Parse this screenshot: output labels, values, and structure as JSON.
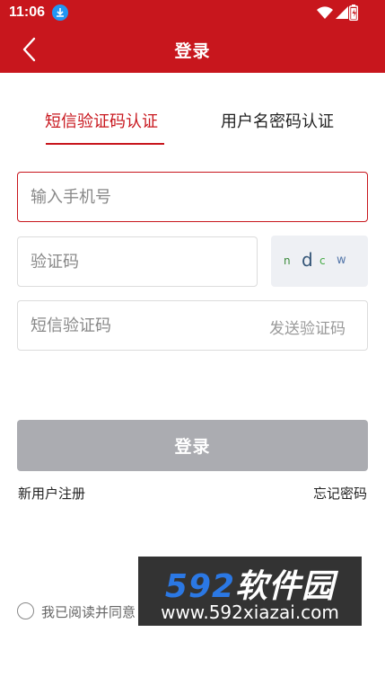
{
  "status_bar": {
    "time": "11:06"
  },
  "header": {
    "title": "登录"
  },
  "tabs": [
    {
      "label": "短信验证码认证",
      "active": true
    },
    {
      "label": "用户名密码认证",
      "active": false
    }
  ],
  "form": {
    "phone_placeholder": "输入手机号",
    "code_placeholder": "验证码",
    "captcha": [
      "n",
      "d",
      "c",
      "w"
    ],
    "sms_placeholder": "短信验证码",
    "send_code_label": "发送验证码"
  },
  "login_button": "登录",
  "links": {
    "register": "新用户注册",
    "forgot": "忘记密码"
  },
  "agreement_text": "我已阅读并同意",
  "watermark": {
    "brand_num": "592",
    "brand_text": "软件园",
    "url": "www.592xiazai.com"
  },
  "colors": {
    "primary": "#c8161d",
    "disabled_button": "#abacb1",
    "captcha_bg": "#eef0f4"
  }
}
